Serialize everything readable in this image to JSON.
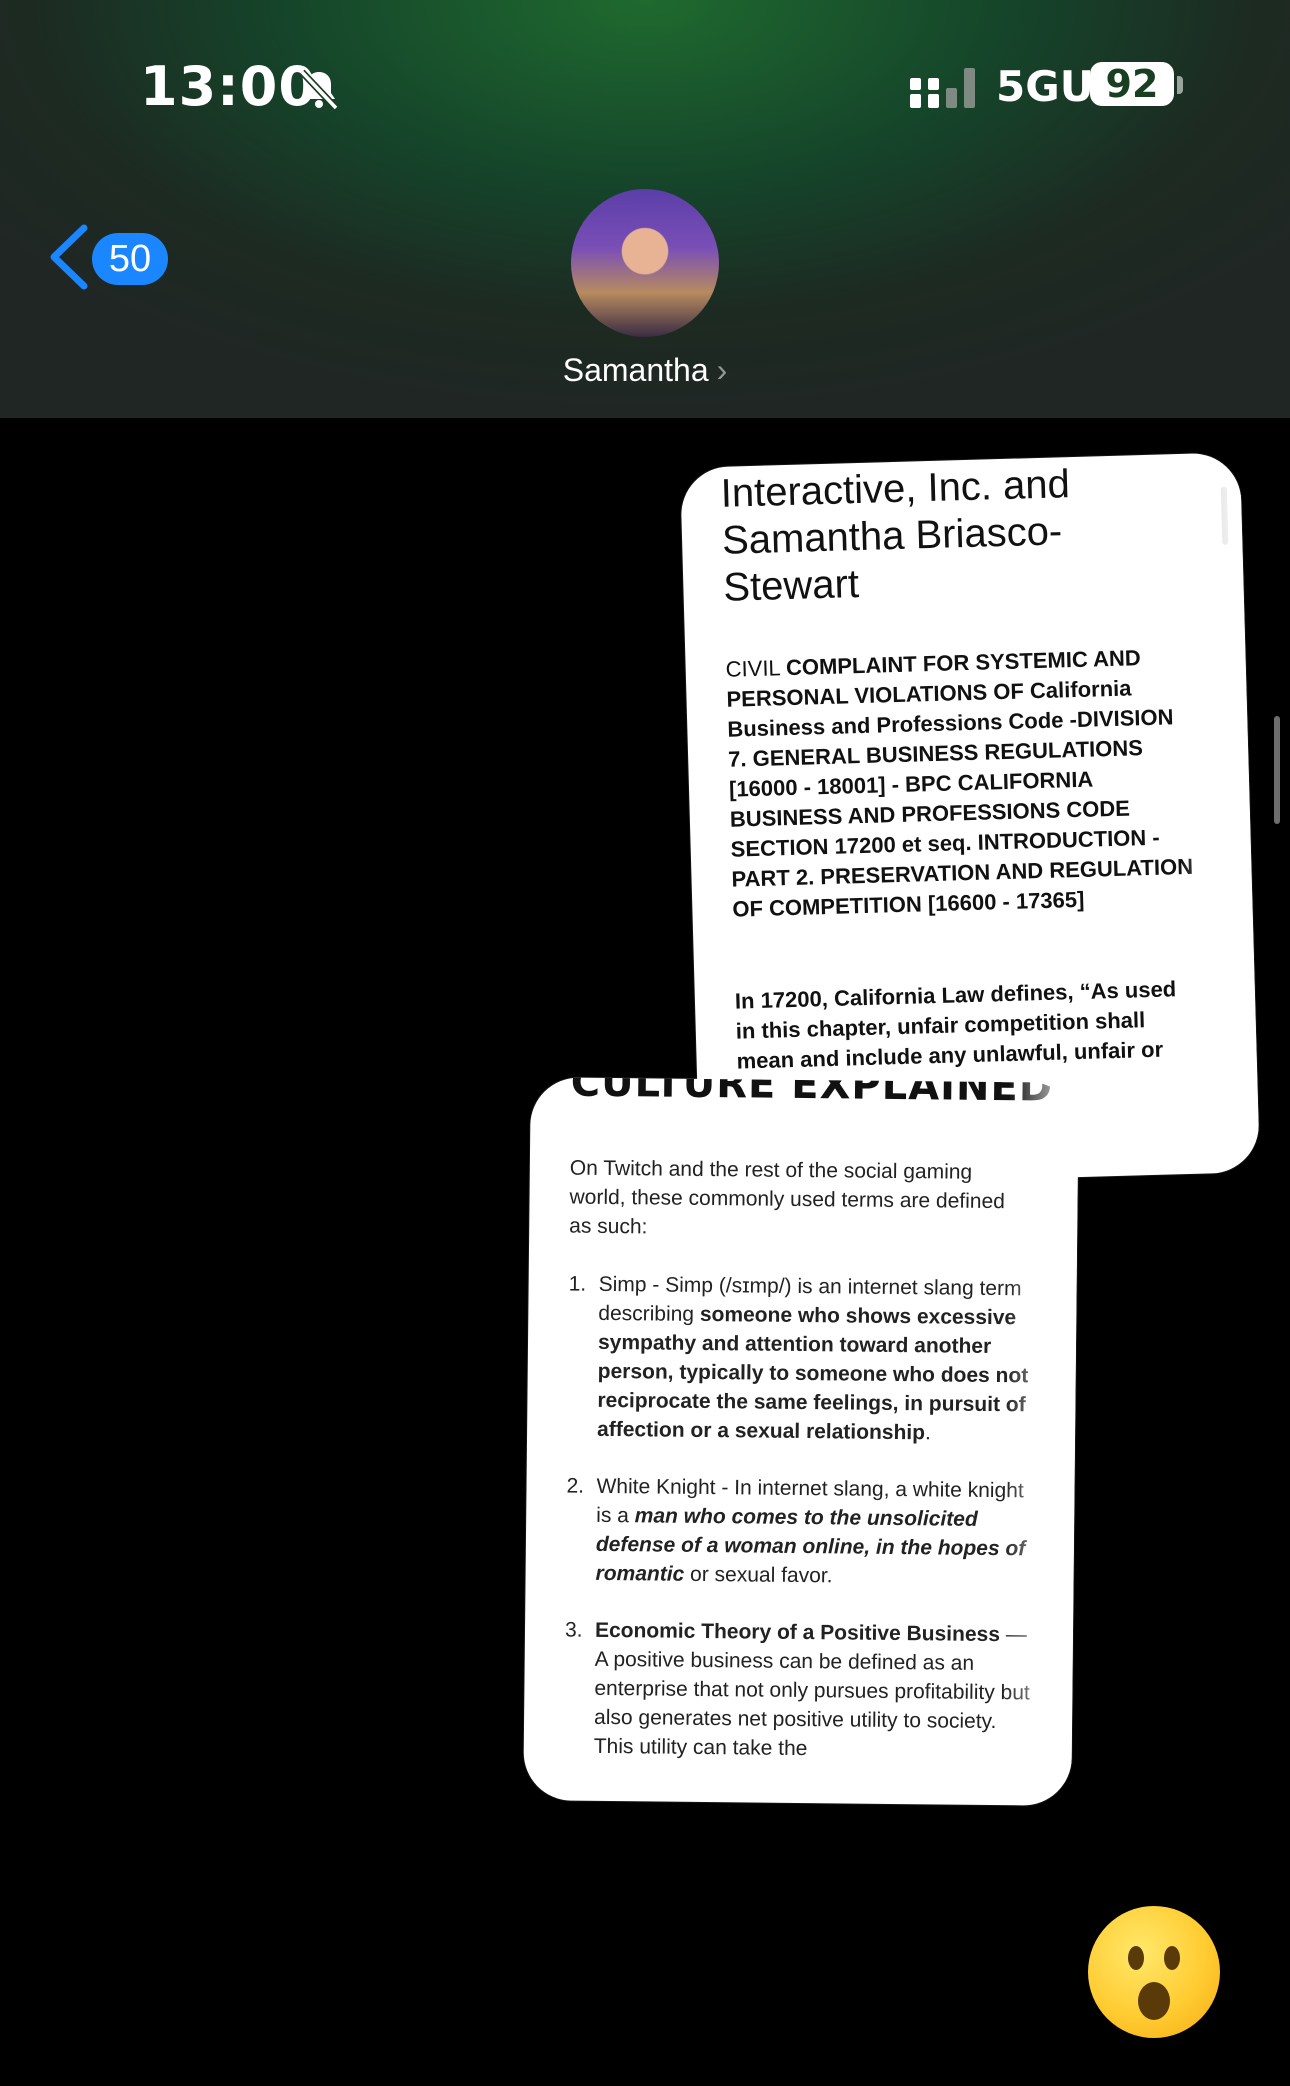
{
  "status_bar": {
    "time": "13:00",
    "network": "5GUC",
    "battery": "92",
    "icons": [
      "bell-slash-icon",
      "signal-icon",
      "battery-icon"
    ]
  },
  "header": {
    "back_count": "50",
    "contact_name": "Samantha",
    "chevron": "›"
  },
  "card1": {
    "title": "Interactive, Inc. and Samantha Briasco-Stewart",
    "civil_prefix": "CIVIL ",
    "complaint_bold": "COMPLAINT FOR SYSTEMIC AND PERSONAL VIOLATIONS OF California Business and Professions Code -DIVISION 7. GENERAL BUSINESS REGULATIONS [16000 - 18001] - BPC CALIFORNIA BUSINESS AND PROFESSIONS CODE SECTION 17200 et seq. INTRODUCTION - PART 2. PRESERVATION AND REGULATION OF COMPETITION [16600 - 17365]",
    "paragraph": "In 17200, California Law defines, “As used in this chapter, unfair competition shall mean and include any unlawful, unfair or"
  },
  "card2": {
    "heading": "CULTURE EXPLAINED",
    "intro": "On Twitch and the rest of the social gaming world, these commonly used terms are defined as such:",
    "items": [
      {
        "num": "1.",
        "lead": "Simp - Simp (/sɪmp/) is an internet slang term describing ",
        "bold": "someone who shows excessive sympathy and attention toward another person, typically to someone who does not reciprocate the same feelings, in pursuit of affection or a sexual relationship",
        "tail": "."
      },
      {
        "num": "2.",
        "lead": "White Knight - In internet slang, a white knight is a ",
        "bold": "man who comes to the unsolicited defense of a woman online, in the hopes of romantic",
        "tail": " or sexual favor."
      },
      {
        "num": "3.",
        "lead": "",
        "bold": "Economic Theory of a Positive Business",
        "tail": " — A positive business can be defined as an enterprise that not only pursues profitability but also generates net positive utility to society. This utility can take the"
      }
    ]
  },
  "reaction": "astonished-face-emoji"
}
